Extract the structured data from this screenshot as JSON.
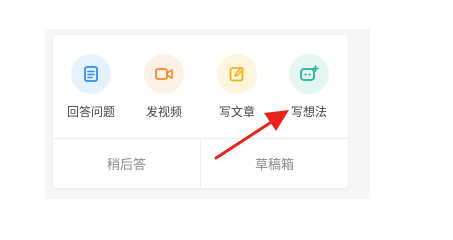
{
  "actions": [
    {
      "label": "回答问题",
      "icon": "answer-doc-icon",
      "color": "#2e8ef0"
    },
    {
      "label": "发视频",
      "icon": "video-camera-icon",
      "color": "#f08c2e"
    },
    {
      "label": "写文章",
      "icon": "edit-pencil-icon",
      "color": "#f0b020"
    },
    {
      "label": "写想法",
      "icon": "idea-chat-icon",
      "color": "#1fb596"
    }
  ],
  "footer": {
    "later_label": "稍后答",
    "drafts_label": "草稿箱"
  },
  "annotation": {
    "arrow_color": "#e8231b"
  }
}
